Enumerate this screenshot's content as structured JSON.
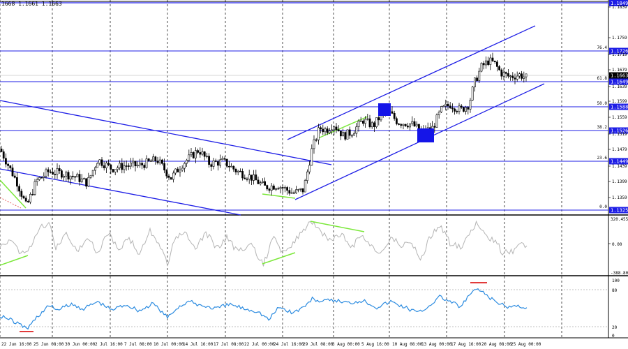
{
  "header": {
    "ohlc_text": "1668 1.1661 1.1663"
  },
  "colors": {
    "grid": "#000000",
    "level_line": "#1e1ee6",
    "channel": "#1e1ee6",
    "candle": "#000000",
    "green": "#7be83a",
    "box": "#1515e8",
    "cci": "#b4b4b4",
    "rsi": "#2b8be0",
    "red": "#e23b3b",
    "label_bg": "#1e1ee6"
  },
  "chart_data": [
    {
      "type": "candlestick",
      "price_axis": {
        "min": 1.1325,
        "max": 1.1849,
        "tick_labels": [
          "1.1839",
          "1.1759",
          "1.1719",
          "1.1679",
          "1.1639",
          "1.1599",
          "1.1559",
          "1.1519",
          "1.1479",
          "1.1439",
          "1.1399",
          "1.1359"
        ]
      },
      "fibonacci_levels": [
        {
          "label": "76.4",
          "price_label": "1.1726"
        },
        {
          "label": "61.8",
          "price_label": "1.1649"
        },
        {
          "label": "50.0",
          "price_label": "1.1588"
        },
        {
          "label": "38.2",
          "price_label": "1.1526"
        },
        {
          "label": "23.6",
          "price_label": "1.1449"
        },
        {
          "label": "0.0",
          "price_label": "1.1325"
        }
      ],
      "top_level_label": "1.1849",
      "current_price_label": "1.1663",
      "time_axis_labels": [
        "22 Jun 16:00",
        "25 Jun 08:00",
        "30 Jun 00:00",
        "2 Jul 16:00",
        "7 Jul 08:00",
        "10 Jul 00:00",
        "14 Jul 16:00",
        "17 Jul 08:00",
        "22 Jul 00:00",
        "24 Jul 16:00",
        "29 Jul 08:00",
        "3 Aug 00:00",
        "5 Aug 16:00",
        "10 Aug 08:00",
        "13 Aug 00:00",
        "17 Aug 16:00",
        "20 Aug 08:00",
        "25 Aug 00:00"
      ]
    },
    {
      "type": "line",
      "indicator": "cci",
      "tick_labels": [
        "320.4558",
        "0.00",
        "-388.8031"
      ]
    },
    {
      "type": "line",
      "indicator": "rsi",
      "tick_labels": [
        "100",
        "80",
        "20",
        "0"
      ]
    }
  ]
}
